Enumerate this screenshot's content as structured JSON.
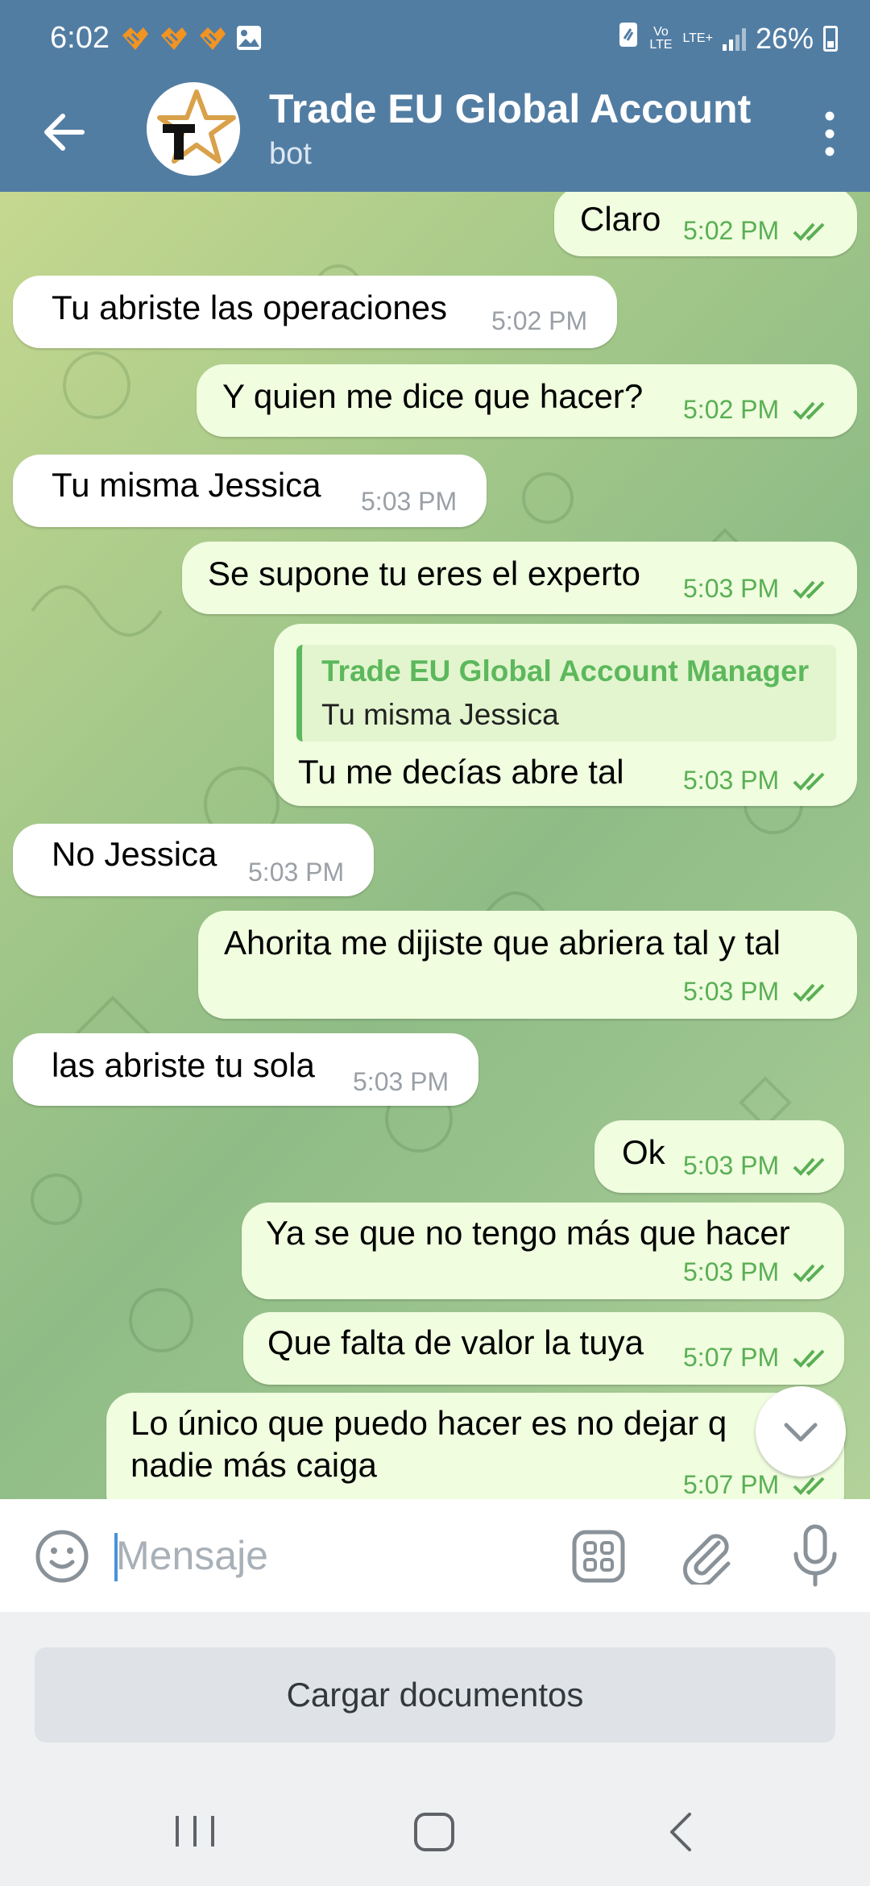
{
  "status_bar": {
    "time": "6:02",
    "battery": "26%",
    "network_top": "LTE+",
    "volte": "Vo LTE"
  },
  "header": {
    "title": "Trade EU Global Account Manager",
    "subtitle": "bot"
  },
  "messages": [
    {
      "dir": "out",
      "text": "Claro",
      "time": "5:02 PM"
    },
    {
      "dir": "in",
      "text": "Tu abriste las operaciones",
      "time": "5:02 PM"
    },
    {
      "dir": "out",
      "text": "Y quien me dice que hacer?",
      "time": "5:02 PM"
    },
    {
      "dir": "in",
      "text": "Tu misma Jessica",
      "time": "5:03 PM"
    },
    {
      "dir": "out",
      "text": "Se supone tu eres el experto",
      "time": "5:03 PM"
    },
    {
      "dir": "out",
      "reply_to_name": "Trade EU Global Account Manager",
      "reply_to_text": "Tu misma Jessica",
      "text": "Tu me decías abre tal",
      "time": "5:03 PM"
    },
    {
      "dir": "in",
      "text": "No Jessica",
      "time": "5:03 PM"
    },
    {
      "dir": "out",
      "text": "Ahorita me dijiste que abriera tal y tal",
      "time": "5:03 PM"
    },
    {
      "dir": "in",
      "text": "las abriste tu sola",
      "time": "5:03 PM"
    },
    {
      "dir": "out",
      "text": "Ok",
      "time": "5:03 PM"
    },
    {
      "dir": "out",
      "text": "Ya se que no tengo más que hacer",
      "time": "5:03 PM"
    },
    {
      "dir": "out",
      "text": "Que falta de valor la tuya",
      "time": "5:07 PM"
    },
    {
      "dir": "out",
      "text_line1": "Lo único que puedo hacer  es no dejar q",
      "text_line2": "nadie más caiga",
      "time": "5:07 PM"
    }
  ],
  "composer": {
    "placeholder": "Mensaje",
    "upload_label": "Cargar documentos"
  },
  "icons": {
    "back": "arrow-left-icon",
    "menu": "more-vertical-icon",
    "emoji": "emoji-icon",
    "bot_commands": "bot-commands-icon",
    "attach": "paperclip-icon",
    "mic": "microphone-icon",
    "scroll": "chevron-down-icon"
  },
  "colors": {
    "header": "#527da3",
    "outgoing_bubble": "#f0fddf",
    "incoming_bubble": "#ffffff",
    "timestamp_out": "#5aaf55",
    "quote_accent": "#5cb85c"
  }
}
